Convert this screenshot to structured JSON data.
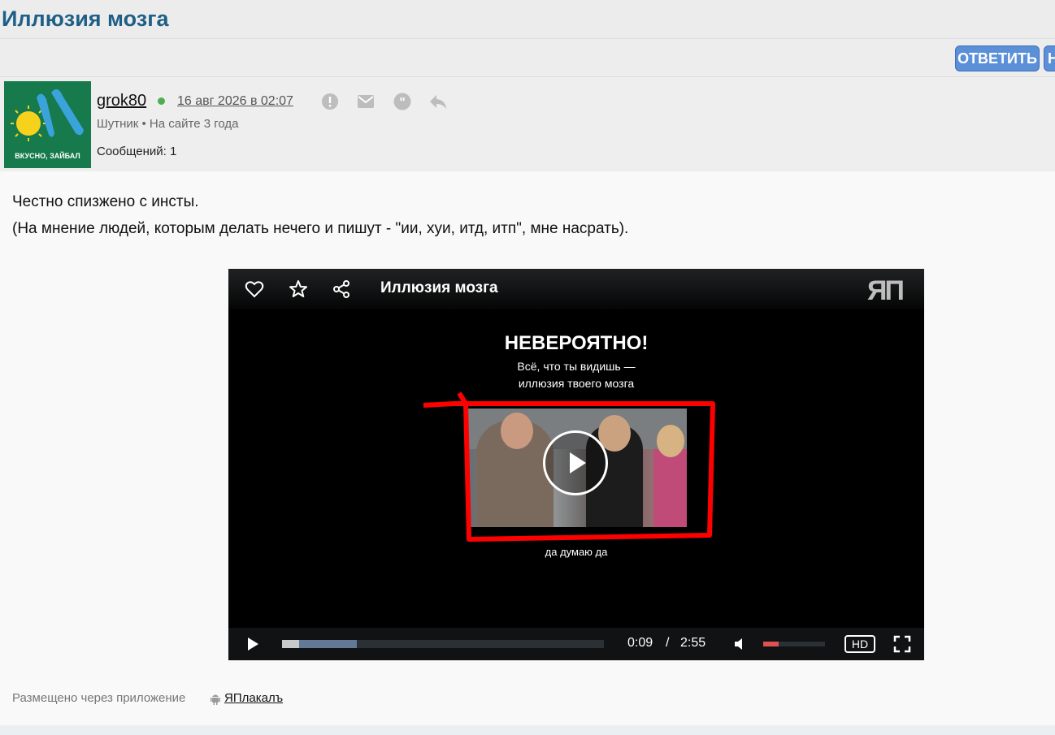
{
  "page": {
    "title": "Иллюзия мозга"
  },
  "actions": {
    "reply_label": "ОТВЕТИТЬ",
    "next_label": "Н"
  },
  "post": {
    "avatar_text": "ВКУСНО, ЗАЙБАЛ",
    "username": "grok80",
    "date": "16 авг 2026 в 02:07",
    "rank": "Шутник  •  На сайте 3 года",
    "message_count": "Сообщений: 1",
    "body_line1": "Честно спизжено с инсты.",
    "body_line2": "(На мнение людей, которым делать нечего и пишут - \"ии, хуи, итд, итп\", мне насрать).",
    "posted_via": "Размещено через приложение",
    "app_name": "ЯПлакалъ",
    "header_icons": [
      "alert-icon",
      "mail-icon",
      "quote-icon",
      "reply-icon"
    ]
  },
  "video": {
    "title": "Иллюзия мозга",
    "logo": "ЯП",
    "headline": "НЕВЕРОЯТНО!",
    "subline1": "Всё, что ты видишь —",
    "subline2": "иллюзия твоего мозга",
    "caption": "да думаю да",
    "current_time": "0:09",
    "separator": "/",
    "duration": "2:55",
    "played_fraction": 0.052,
    "buffered_fraction": 0.232,
    "volume_fraction": 0.25,
    "quality": "HD",
    "colors": {
      "frame": "#ff0000",
      "progress_buffer": "#627896",
      "volume": "#e05252"
    }
  }
}
